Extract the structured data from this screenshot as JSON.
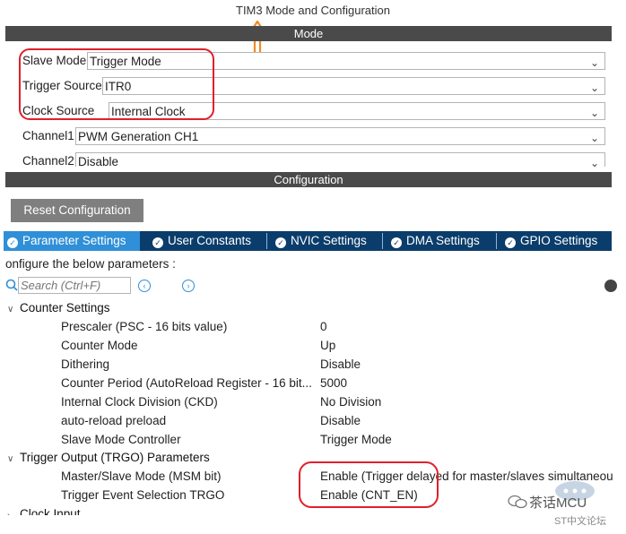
{
  "window_title": "TIM3 Mode and Configuration",
  "mode_header": "Mode",
  "mode_fields": [
    {
      "label": "Slave Mode",
      "value": "Trigger Mode"
    },
    {
      "label": "Trigger Source",
      "value": "ITR0"
    },
    {
      "label": "Clock Source",
      "value": "Internal Clock"
    },
    {
      "label": "Channel1",
      "value": "PWM Generation CH1"
    },
    {
      "label": "Channel2",
      "value": "Disable"
    }
  ],
  "config_header": "Configuration",
  "reset_button": "Reset Configuration",
  "tabs": [
    {
      "label": "Parameter Settings",
      "active": true
    },
    {
      "label": "User Constants",
      "active": false
    },
    {
      "label": "NVIC Settings",
      "active": false
    },
    {
      "label": "DMA Settings",
      "active": false
    },
    {
      "label": "GPIO Settings",
      "active": false
    }
  ],
  "configure_text": "onfigure the below parameters :",
  "search": {
    "placeholder": "Search (Ctrl+F)"
  },
  "groups": [
    {
      "title": "Counter Settings",
      "params": [
        {
          "name": "Prescaler (PSC - 16 bits value)",
          "value": "0"
        },
        {
          "name": "Counter Mode",
          "value": "Up"
        },
        {
          "name": "Dithering",
          "value": "Disable"
        },
        {
          "name": "Counter Period (AutoReload Register - 16 bit...",
          "value": "5000"
        },
        {
          "name": "Internal Clock Division (CKD)",
          "value": "No Division"
        },
        {
          "name": "auto-reload preload",
          "value": "Disable"
        },
        {
          "name": "Slave Mode Controller",
          "value": "Trigger Mode"
        }
      ]
    },
    {
      "title": "Trigger Output (TRGO) Parameters",
      "params": [
        {
          "name": "Master/Slave Mode (MSM bit)",
          "value": "Enable (Trigger delayed for master/slaves simultaneou"
        },
        {
          "name": "Trigger Event Selection TRGO",
          "value": "Enable (CNT_EN)"
        }
      ]
    }
  ],
  "partial_group": "Clock Input",
  "watermark": {
    "brand": "茶话MCU",
    "site": "ST中文论坛"
  },
  "annotation_color": "#e0202a",
  "arrow_color": "#f08a24"
}
